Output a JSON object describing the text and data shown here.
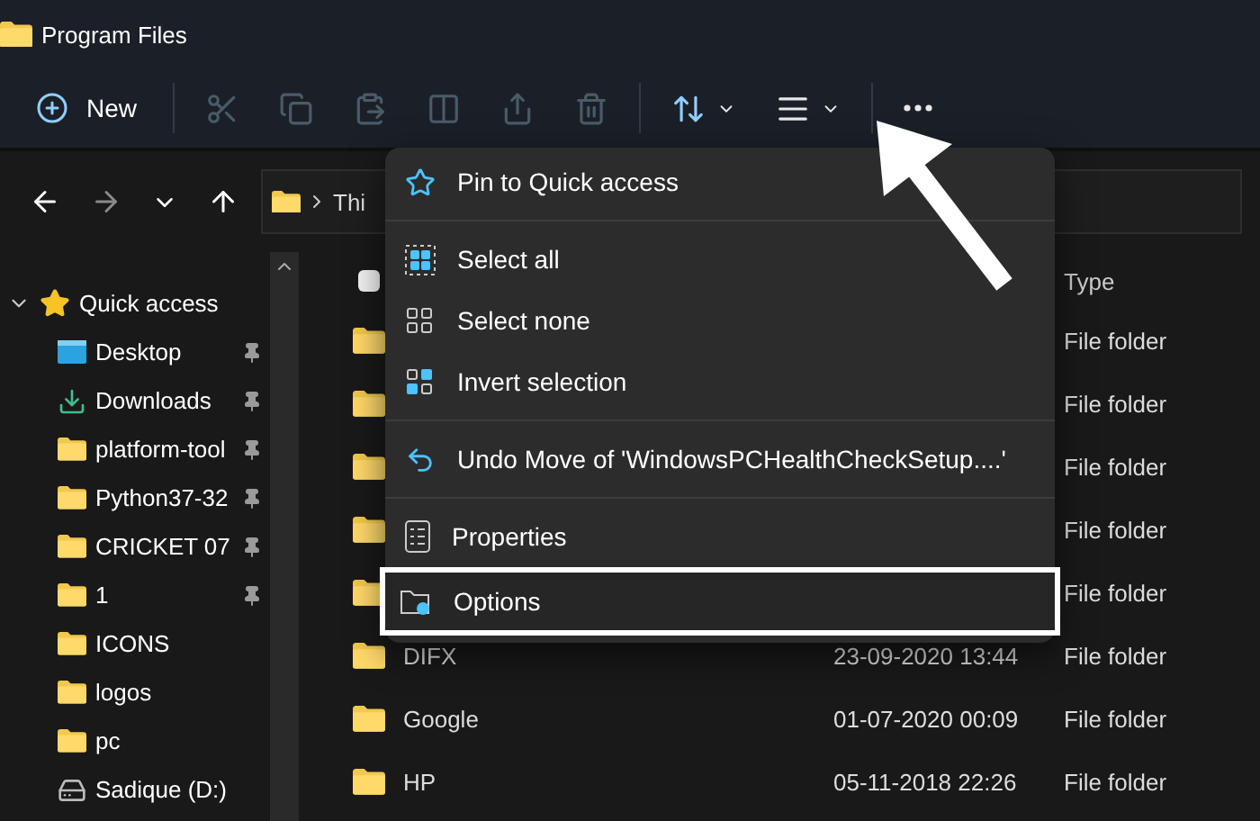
{
  "window": {
    "title": "Program Files"
  },
  "toolbar": {
    "new_label": "New",
    "actions": [
      {
        "disabled": true
      },
      {
        "disabled": true
      },
      {
        "disabled": true
      },
      {
        "disabled": true
      },
      {
        "disabled": true
      },
      {
        "disabled": true
      },
      {
        "disabled": false
      },
      {
        "disabled": false
      }
    ]
  },
  "navigation": [
    {
      "disabled": false
    },
    {
      "disabled": true
    },
    {
      "disabled": false
    },
    {
      "disabled": false
    }
  ],
  "address": {
    "text": "Thi"
  },
  "sidebar": {
    "label": "Quick access",
    "expanded": true,
    "children": [
      {
        "label": "Desktop",
        "pinned": true
      },
      {
        "label": "Downloads",
        "pinned": true
      },
      {
        "label": "platform-tool",
        "pinned": true
      },
      {
        "label": "Python37-32",
        "pinned": true
      },
      {
        "label": "CRICKET 07",
        "pinned": true
      },
      {
        "label": "1",
        "pinned": true
      },
      {
        "label": "ICONS",
        "pinned": false
      },
      {
        "label": "logos",
        "pinned": false
      },
      {
        "label": "pc",
        "pinned": false
      },
      {
        "label": "Sadique (D:)",
        "pinned": false
      }
    ]
  },
  "content": {
    "select_all_checked": false,
    "type_header": "Type",
    "rows": [
      {
        "type": "File folder"
      },
      {
        "type": "File folder"
      },
      {
        "type": "File folder"
      },
      {
        "type": "File folder"
      },
      {
        "type": "File folder"
      },
      {
        "name": "DIFX",
        "date": "23-09-2020 13:44",
        "type": "File folder"
      },
      {
        "name": "Google",
        "date": "01-07-2020 00:09",
        "type": "File folder"
      },
      {
        "name": "HP",
        "date": "05-11-2018 22:26",
        "type": "File folder"
      }
    ]
  },
  "menu": {
    "items": [
      {
        "label": "Pin to Quick access",
        "divider_after": true,
        "highlighted": false
      },
      {
        "label": "Select all",
        "divider_after": false,
        "highlighted": false
      },
      {
        "label": "Select none",
        "divider_after": false,
        "highlighted": false
      },
      {
        "label": "Invert selection",
        "divider_after": true,
        "highlighted": false
      },
      {
        "label": "Undo Move of 'WindowsPCHealthCheckSetup....'",
        "divider_after": true,
        "highlighted": false
      },
      {
        "label": "Properties",
        "divider_after": false,
        "highlighted": false
      },
      {
        "label": "Options",
        "divider_after": false,
        "highlighted": true
      }
    ]
  }
}
